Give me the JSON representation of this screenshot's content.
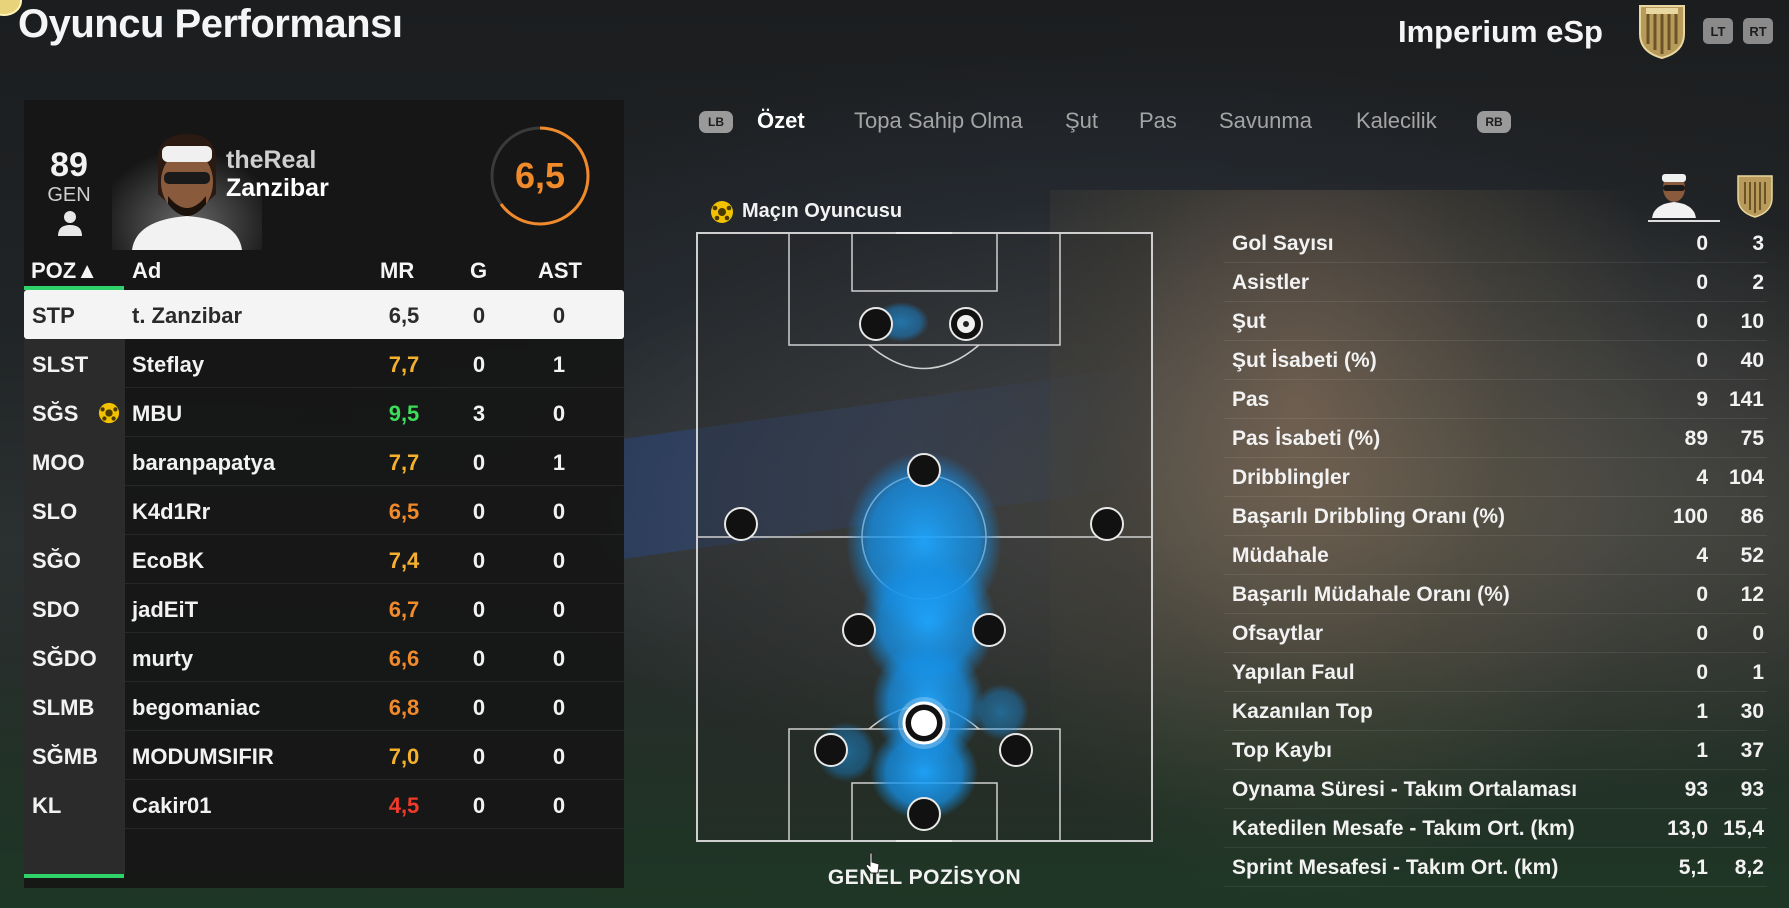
{
  "header": {
    "title": "Oyuncu Performansı",
    "team_name": "Imperium eSp",
    "lt_label": "LT",
    "rt_label": "RT"
  },
  "player": {
    "overall": "89",
    "overall_label": "GEN",
    "name_line1": "theReal",
    "name_line2": "Zanzibar",
    "match_rating": "6,5"
  },
  "table": {
    "headers": {
      "pos": "POZ▲",
      "name": "Ad",
      "mr": "MR",
      "g": "G",
      "ast": "AST"
    },
    "rows": [
      {
        "pos": "STP",
        "name": "t. Zanzibar",
        "mr": "6,5",
        "g": "0",
        "ast": "0",
        "mr_color": "#2a2a2a"
      },
      {
        "pos": "SLST",
        "name": "Steflay",
        "mr": "7,7",
        "g": "0",
        "ast": "1",
        "mr_color": "#f5b02e"
      },
      {
        "pos": "SĞS",
        "name": "MBU",
        "mr": "9,5",
        "g": "3",
        "ast": "0",
        "mr_color": "#3ddc5a"
      },
      {
        "pos": "MOO",
        "name": "baranpapatya",
        "mr": "7,7",
        "g": "0",
        "ast": "1",
        "mr_color": "#f5b02e"
      },
      {
        "pos": "SLO",
        "name": "K4d1Rr",
        "mr": "6,5",
        "g": "0",
        "ast": "0",
        "mr_color": "#f08a2a"
      },
      {
        "pos": "SĞO",
        "name": "EcoBK",
        "mr": "7,4",
        "g": "0",
        "ast": "0",
        "mr_color": "#f5b02e"
      },
      {
        "pos": "SDO",
        "name": "jadEiT",
        "mr": "6,7",
        "g": "0",
        "ast": "0",
        "mr_color": "#f08a2a"
      },
      {
        "pos": "SĞDO",
        "name": "murty",
        "mr": "6,6",
        "g": "0",
        "ast": "0",
        "mr_color": "#f08a2a"
      },
      {
        "pos": "SLMB",
        "name": "begomaniac",
        "mr": "6,8",
        "g": "0",
        "ast": "0",
        "mr_color": "#f08a2a"
      },
      {
        "pos": "SĞMB",
        "name": "MODUMSIFIR",
        "mr": "7,0",
        "g": "0",
        "ast": "0",
        "mr_color": "#f5b02e"
      },
      {
        "pos": "KL",
        "name": "Cakir01",
        "mr": "4,5",
        "g": "0",
        "ast": "0",
        "mr_color": "#f03a2a"
      }
    ]
  },
  "tabs": {
    "lb": "LB",
    "rb": "RB",
    "items": [
      "Özet",
      "Topa Sahip Olma",
      "Şut",
      "Pas",
      "Savunma",
      "Kalecilik"
    ],
    "active_index": 0
  },
  "pitch": {
    "motm_label": "Maçın Oyuncusu",
    "caption": "GENEL POZİSYON",
    "heat_color": "#1ea6ff"
  },
  "stats": [
    {
      "label": "Gol Sayısı",
      "me": "0",
      "team": "3"
    },
    {
      "label": "Asistler",
      "me": "0",
      "team": "2"
    },
    {
      "label": "Şut",
      "me": "0",
      "team": "10"
    },
    {
      "label": "Şut İsabeti (%)",
      "me": "0",
      "team": "40"
    },
    {
      "label": "Pas",
      "me": "9",
      "team": "141"
    },
    {
      "label": "Pas İsabeti (%)",
      "me": "89",
      "team": "75"
    },
    {
      "label": "Dribblingler",
      "me": "4",
      "team": "104"
    },
    {
      "label": "Başarılı Dribbling Oranı (%)",
      "me": "100",
      "team": "86"
    },
    {
      "label": "Müdahale",
      "me": "4",
      "team": "52"
    },
    {
      "label": "Başarılı Müdahale Oranı (%)",
      "me": "0",
      "team": "12"
    },
    {
      "label": "Ofsaytlar",
      "me": "0",
      "team": "0"
    },
    {
      "label": "Yapılan Faul",
      "me": "0",
      "team": "1"
    },
    {
      "label": "Kazanılan Top",
      "me": "1",
      "team": "30"
    },
    {
      "label": "Top Kaybı",
      "me": "1",
      "team": "37"
    },
    {
      "label": "Oynama Süresi - Takım Ortalaması",
      "me": "93",
      "team": "93"
    },
    {
      "label": "Katedilen Mesafe - Takım Ort. (km)",
      "me": "13,0",
      "team": "15,4"
    },
    {
      "label": "Sprint Mesafesi - Takım Ort. (km)",
      "me": "5,1",
      "team": "8,2"
    }
  ],
  "colors": {
    "accent_green": "#2fd36a",
    "rating_orange": "#f08a2a",
    "rating_yellow": "#f5b02e",
    "rating_green": "#3ddc5a",
    "rating_red": "#f03a2a"
  },
  "icons": {
    "motm": "soccer-ball-gold-icon",
    "person": "person-icon",
    "crest": "team-crest-icon"
  }
}
